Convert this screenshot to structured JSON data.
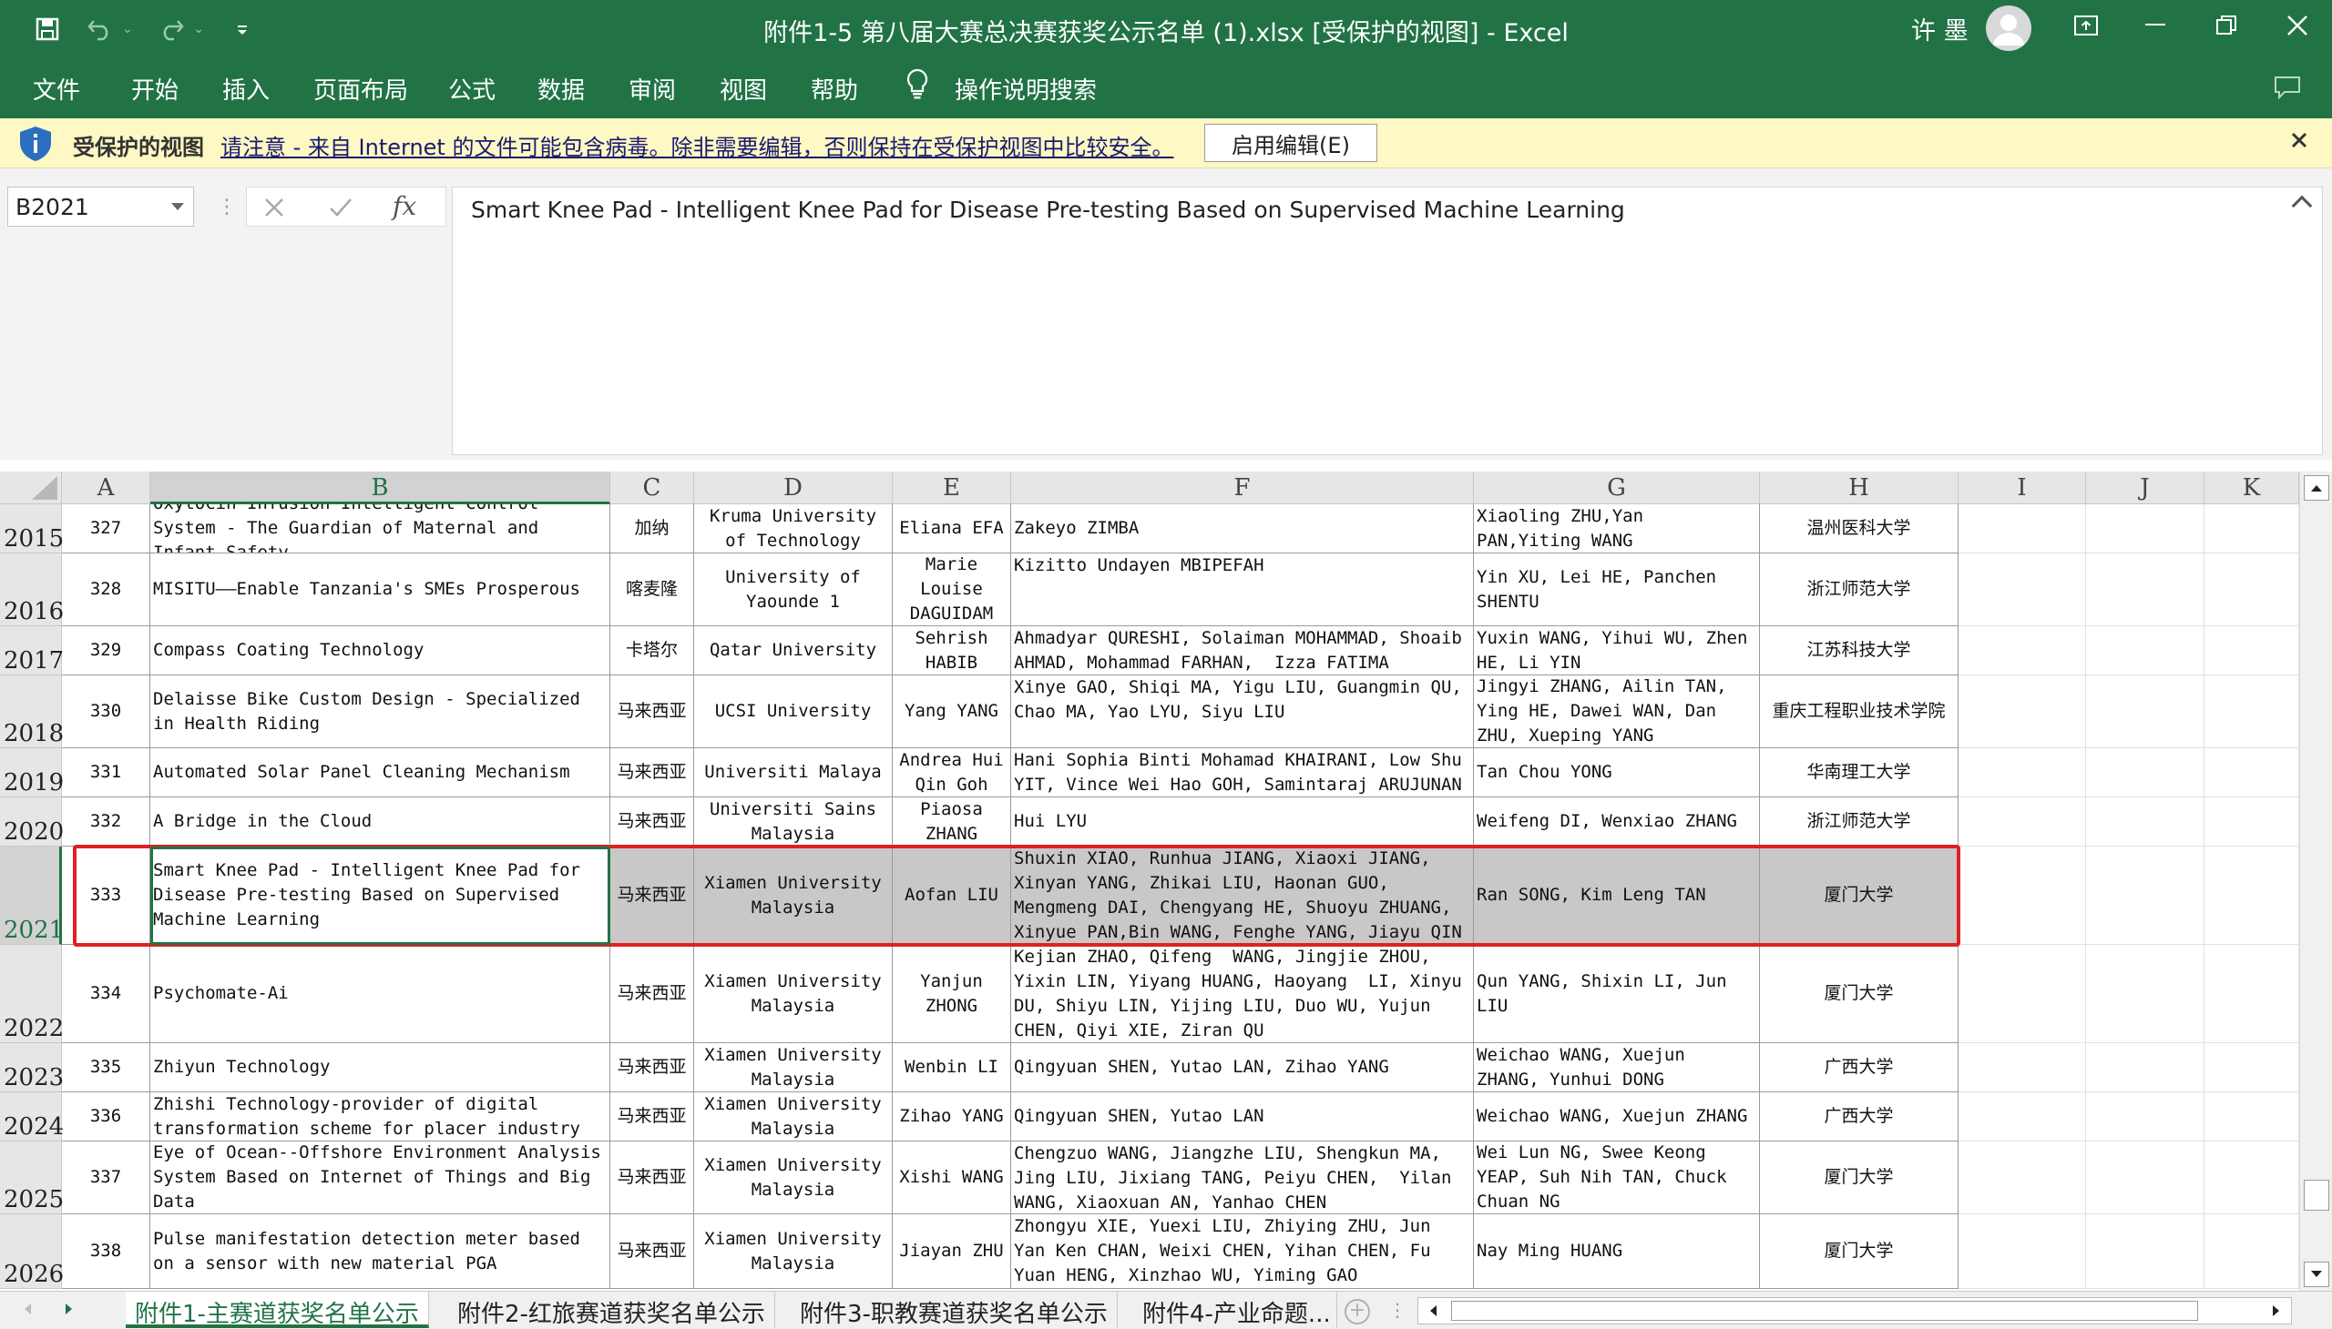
{
  "window": {
    "title": "附件1-5 第八届大赛总决赛获奖公示名单 (1).xlsx  [受保护的视图]  -  Excel",
    "user_name": "许 墨",
    "qat_more": "⌄"
  },
  "ribbon_tabs": [
    "文件",
    "开始",
    "插入",
    "页面布局",
    "公式",
    "数据",
    "审阅",
    "视图",
    "帮助",
    "操作说明搜索"
  ],
  "protected_view": {
    "title": "受保护的视图",
    "message": "请注意 - 来自 Internet 的文件可能包含病毒。除非需要编辑，否则保持在受保护视图中比较安全。",
    "enable_button": "启用编辑(E)"
  },
  "formula_bar": {
    "name_box": "B2021",
    "fx": "fx",
    "content": "Smart Knee Pad - Intelligent Knee Pad for Disease Pre-testing Based on Supervised Machine Learning"
  },
  "columns": [
    "A",
    "B",
    "C",
    "D",
    "E",
    "F",
    "G",
    "H",
    "I",
    "J",
    "K"
  ],
  "selected_cell": {
    "row": "2021",
    "column": "B"
  },
  "rows": [
    {
      "num": "2015",
      "cells": [
        "327",
        "Oxytocin Infusion Intelligent Control System - The Guardian of Maternal and Infant Safety",
        "加纳",
        "Kruma University of Technology",
        "Eliana EFA",
        "Zakeyo ZIMBA",
        "Xiaoling ZHU,Yan PAN,Yiting WANG",
        "温州医科大学"
      ]
    },
    {
      "num": "2016",
      "cells": [
        "328",
        "MISITU——Enable Tanzania's SMEs Prosperous",
        "喀麦隆",
        "University of Yaounde 1",
        "Marie Louise DAGUIDAM",
        "Kizitto Undayen MBIPEFAH",
        "Yin XU, Lei HE, Panchen SHENTU",
        "浙江师范大学"
      ]
    },
    {
      "num": "2017",
      "cells": [
        "329",
        "Compass Coating Technology",
        "卡塔尔",
        "Qatar University",
        "Sehrish HABIB",
        "Ahmadyar QURESHI, Solaiman MOHAMMAD, Shoaib AHMAD, Mohammad FARHAN,  Izza FATIMA",
        "Yuxin WANG, Yihui WU, Zhen HE, Li YIN",
        "江苏科技大学"
      ]
    },
    {
      "num": "2018",
      "cells": [
        "330",
        "Delaisse Bike Custom Design - Specialized in Health Riding",
        "马来西亚",
        "UCSI University",
        "Yang YANG",
        "Xinye GAO, Shiqi MA, Yigu LIU, Guangmin QU, Chao MA, Yao LYU, Siyu LIU",
        "Jingyi ZHANG, Ailin TAN, Ying HE, Dawei WAN, Dan ZHU, Xueping YANG",
        "重庆工程职业技术学院"
      ]
    },
    {
      "num": "2019",
      "cells": [
        "331",
        "Automated Solar Panel Cleaning Mechanism",
        "马来西亚",
        "Universiti Malaya",
        "Andrea Hui Qin Goh",
        "Hani Sophia Binti Mohamad KHAIRANI, Low Shu YIT, Vince Wei Hao GOH, Samintaraj ARUJUNAN",
        "Tan Chou YONG",
        "华南理工大学"
      ]
    },
    {
      "num": "2020",
      "cells": [
        "332",
        "A Bridge in the Cloud",
        "马来西亚",
        "Universiti Sains Malaysia",
        "Piaosa ZHANG",
        "Hui LYU",
        "Weifeng DI, Wenxiao ZHANG",
        "浙江师范大学"
      ]
    },
    {
      "num": "2021",
      "cells": [
        "333",
        "Smart Knee Pad - Intelligent Knee Pad for Disease Pre-testing Based on Supervised Machine Learning",
        "马来西亚",
        "Xiamen University Malaysia",
        "Aofan LIU",
        "Shuxin XIAO, Runhua JIANG, Xiaoxi JIANG, Xinyan YANG, Zhikai LIU, Haonan GUO, Mengmeng DAI, Chengyang HE, Shuoyu ZHUANG, Xinyue PAN,Bin WANG, Fenghe YANG, Jiayu QIN",
        "Ran SONG, Kim Leng TAN",
        "厦门大学"
      ]
    },
    {
      "num": "2022",
      "cells": [
        "334",
        "Psychomate-Ai",
        "马来西亚",
        "Xiamen University Malaysia",
        "Yanjun ZHONG",
        "Kejian ZHAO, Qifeng  WANG, Jingjie ZHOU, Yixin LIN, Yiyang HUANG, Haoyang  LI, Xinyu DU, Shiyu LIN, Yijing LIU, Duo WU, Yujun CHEN, Qiyi XIE, Ziran QU",
        "Qun YANG, Shixin LI, Jun LIU",
        "厦门大学"
      ]
    },
    {
      "num": "2023",
      "cells": [
        "335",
        "Zhiyun Technology",
        "马来西亚",
        "Xiamen University Malaysia",
        "Wenbin LI",
        "Qingyuan SHEN, Yutao LAN, Zihao YANG",
        "Weichao WANG, Xuejun ZHANG, Yunhui DONG",
        "广西大学"
      ]
    },
    {
      "num": "2024",
      "cells": [
        "336",
        "Zhishi Technology-provider of digital transformation scheme for placer industry",
        "马来西亚",
        "Xiamen University Malaysia",
        "Zihao YANG",
        "Qingyuan SHEN, Yutao LAN",
        "Weichao WANG, Xuejun ZHANG",
        "广西大学"
      ]
    },
    {
      "num": "2025",
      "cells": [
        "337",
        "Eye of Ocean--Offshore Environment Analysis System Based on Internet of Things and Big Data",
        "马来西亚",
        "Xiamen University Malaysia",
        "Xishi WANG",
        "Chengzuo WANG, Jiangzhe LIU, Shengkun MA, Jing LIU, Jixiang TANG, Peiyu CHEN,  Yilan WANG, Xiaoxuan AN, Yanhao CHEN",
        "Wei Lun NG, Swee Keong YEAP, Suh Nih TAN, Chuck Chuan NG",
        "厦门大学"
      ]
    },
    {
      "num": "2026",
      "cells": [
        "338",
        "Pulse manifestation detection meter based on a sensor with new material PGA",
        "马来西亚",
        "Xiamen University Malaysia",
        "Jiayan ZHU",
        "Zhongyu XIE, Yuexi LIU, Zhiying ZHU, Jun Yan Ken CHAN, Weixi CHEN, Yihan CHEN, Fu Yuan HENG, Xinzhao WU, Yiming GAO",
        "Nay Ming HUANG",
        "厦门大学"
      ]
    }
  ],
  "sheet_tabs": [
    "附件1-主赛道获奖名单公示",
    "附件2-红旅赛道获奖名单公示",
    "附件3-职教赛道获奖名单公示",
    "附件4-产业命题..."
  ],
  "active_sheet": "附件1-主赛道获奖名单公示",
  "colors": {
    "excel_green": "#217346",
    "highlight_red": "#e02020",
    "pv_yellow": "#fdf8c4",
    "selected_row_fill": "#c8c8c8"
  }
}
